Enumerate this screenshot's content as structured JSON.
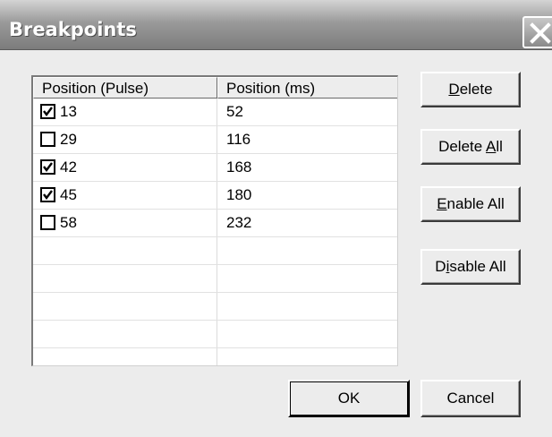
{
  "window": {
    "title": "Breakpoints"
  },
  "list": {
    "headers": [
      "Position (Pulse)",
      "Position (ms)"
    ],
    "rows": [
      {
        "pulse": "13",
        "ms": "52",
        "enabled": true
      },
      {
        "pulse": "29",
        "ms": "116",
        "enabled": false
      },
      {
        "pulse": "42",
        "ms": "168",
        "enabled": true
      },
      {
        "pulse": "45",
        "ms": "180",
        "enabled": true
      },
      {
        "pulse": "58",
        "ms": "232",
        "enabled": false
      }
    ]
  },
  "buttons": {
    "delete": {
      "pre": "",
      "mn": "D",
      "post": "elete"
    },
    "delete_all": {
      "pre": "Delete ",
      "mn": "A",
      "post": "ll"
    },
    "enable_all": {
      "pre": "",
      "mn": "E",
      "post": "nable All"
    },
    "disable_all": {
      "pre": "D",
      "mn": "i",
      "post": "sable All"
    },
    "ok": "OK",
    "cancel": "Cancel"
  }
}
